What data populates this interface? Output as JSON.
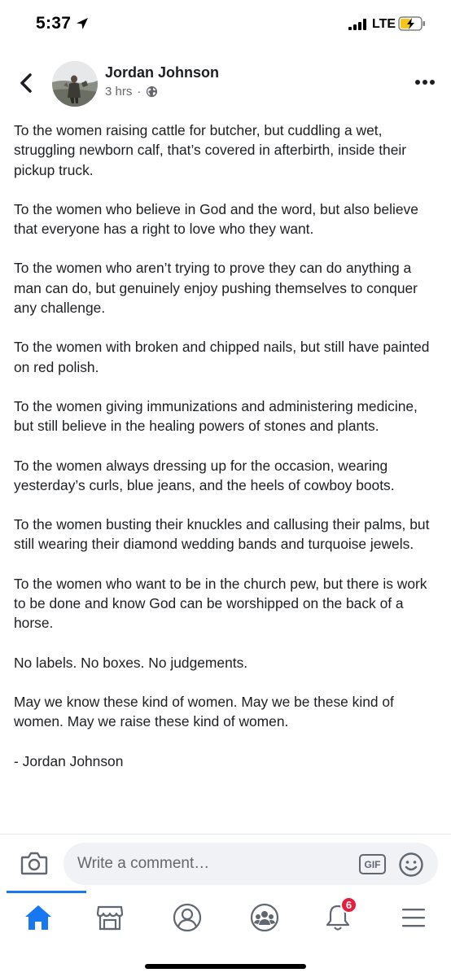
{
  "status_bar": {
    "time": "5:37",
    "network": "LTE"
  },
  "post": {
    "author": "Jordan Johnson",
    "time_ago": "3 hrs",
    "separator": "·",
    "privacy_icon": "globe-icon",
    "paragraphs": [
      "To the women raising cattle for butcher, but cuddling a wet, struggling newborn calf, that’s covered in afterbirth, inside their pickup truck.",
      "To the women who believe in God and the word, but also believe that everyone has a right to love who they want.",
      "To the women who aren’t trying to prove they can do anything a man can do, but genuinely enjoy pushing themselves to conquer any challenge.",
      "To the women with broken and chipped nails, but still have painted on red polish.",
      "To the women giving immunizations and administering medicine, but still believe in the healing powers of stones and plants.",
      "To the women always dressing up for the occasion, wearing yesterday’s curls, blue jeans, and the heels of cowboy boots.",
      "To the women busting their knuckles and callusing their palms, but still wearing their diamond wedding bands and turquoise jewels.",
      "To the women who want to be in the church pew, but there is work to be done and know God can be worshipped on the back of a horse.",
      "No labels. No boxes. No judgements.",
      "May we know these kind of women. May we be these kind of women. May we raise these kind of women.",
      "- Jordan Johnson"
    ]
  },
  "comment_bar": {
    "placeholder": "Write a comment…",
    "gif_label": "GIF"
  },
  "bottom_nav": {
    "items": [
      {
        "name": "home",
        "icon": "home-icon",
        "active": true
      },
      {
        "name": "marketplace",
        "icon": "marketplace-icon",
        "active": false
      },
      {
        "name": "profile",
        "icon": "profile-icon",
        "active": false
      },
      {
        "name": "groups",
        "icon": "groups-icon",
        "active": false
      },
      {
        "name": "notifications",
        "icon": "bell-icon",
        "active": false
      },
      {
        "name": "menu",
        "icon": "menu-icon",
        "active": false
      }
    ],
    "notification_count": "6"
  },
  "colors": {
    "accent": "#1877f2",
    "badge": "#e41e3f",
    "secondary_text": "#65676b",
    "input_bg": "#f0f2f5"
  }
}
